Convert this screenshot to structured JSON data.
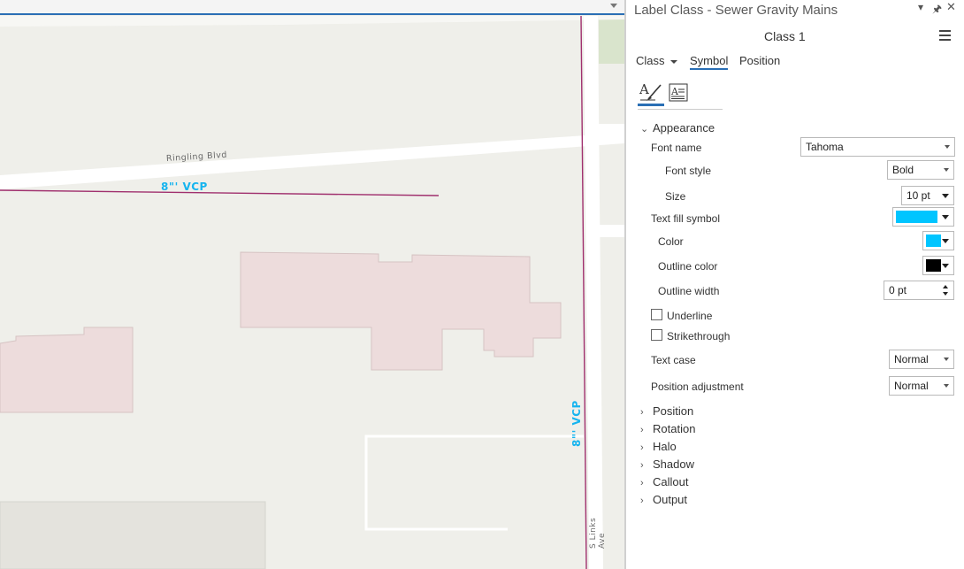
{
  "map": {
    "roads": {
      "ringling": "Ringling Blvd",
      "links": "S Links Ave"
    },
    "pipe_labels": {
      "horizontal": "8\"' VCP",
      "vertical": "8\"' VCP"
    },
    "colors": {
      "background": "#efefea",
      "road": "#ffffff",
      "building": "#eddcdc",
      "building_outline": "#d6c3c3",
      "pipe": "#a0306e",
      "label": "#16b4ef",
      "park": "#d9e4cc"
    }
  },
  "panel": {
    "title": "Label Class - Sewer Gravity Mains",
    "title_buttons": [
      "dropdown",
      "pin",
      "close"
    ],
    "class_name": "Class 1",
    "tabs": [
      "Class",
      "Symbol",
      "Position"
    ],
    "active_tab": "Symbol",
    "sub_tabs": [
      "text-symbol-icon",
      "text-format-icon"
    ],
    "appearance": {
      "heading": "Appearance",
      "font_name_label": "Font name",
      "font_name_value": "Tahoma",
      "font_style_label": "Font style",
      "font_style_value": "Bold",
      "size_label": "Size",
      "size_value": "10 pt",
      "text_fill_label": "Text fill symbol",
      "text_fill_color": "#00c5ff",
      "color_label": "Color",
      "color_value": "#00c5ff",
      "outline_color_label": "Outline color",
      "outline_color_value": "#000000",
      "outline_width_label": "Outline width",
      "outline_width_value": "0 pt",
      "underline_label": "Underline",
      "strikethrough_label": "Strikethrough",
      "text_case_label": "Text case",
      "text_case_value": "Normal",
      "position_adjustment_label": "Position adjustment",
      "position_adjustment_value": "Normal"
    },
    "collapsed_sections": [
      "Position",
      "Rotation",
      "Halo",
      "Shadow",
      "Callout",
      "Output"
    ]
  }
}
